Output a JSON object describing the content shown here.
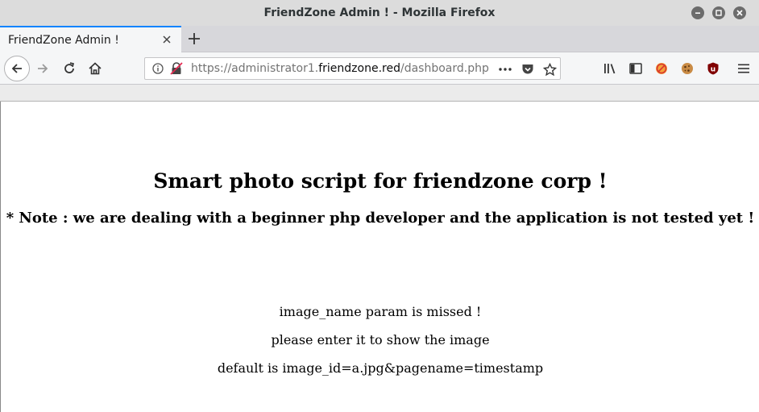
{
  "window": {
    "title": "FriendZone Admin ! - Mozilla Firefox"
  },
  "tabs": [
    {
      "label": "FriendZone Admin !"
    }
  ],
  "navbar": {
    "url_prefix": "https://administrator1.",
    "url_host": "friendzone.red",
    "url_path": "/dashboard.php"
  },
  "page": {
    "heading": "Smart photo script for friendzone corp !",
    "note": "* Note : we are dealing with a beginner php developer and the application is not tested yet !",
    "messages": [
      "image_name param is missed !",
      "please enter it to show the image",
      "default is image_id=a.jpg&pagename=timestamp"
    ]
  },
  "icons": {
    "minimize": "minimize-icon",
    "maximize": "maximize-icon",
    "close": "close-icon",
    "tab_close": "tab-close-icon",
    "new_tab": "plus-icon",
    "back": "arrow-left-icon",
    "forward": "arrow-right-icon",
    "reload": "reload-icon",
    "home": "home-icon",
    "info": "info-icon",
    "lock": "insecure-lock-icon",
    "page_actions": "more-icon",
    "pocket": "pocket-icon",
    "bookmark": "star-icon",
    "library": "library-icon",
    "sidebar": "sidebar-icon",
    "ext1": "blocked-extension-icon",
    "ext2": "cookie-icon",
    "ext3": "ublock-icon",
    "menu": "hamburger-menu-icon"
  }
}
